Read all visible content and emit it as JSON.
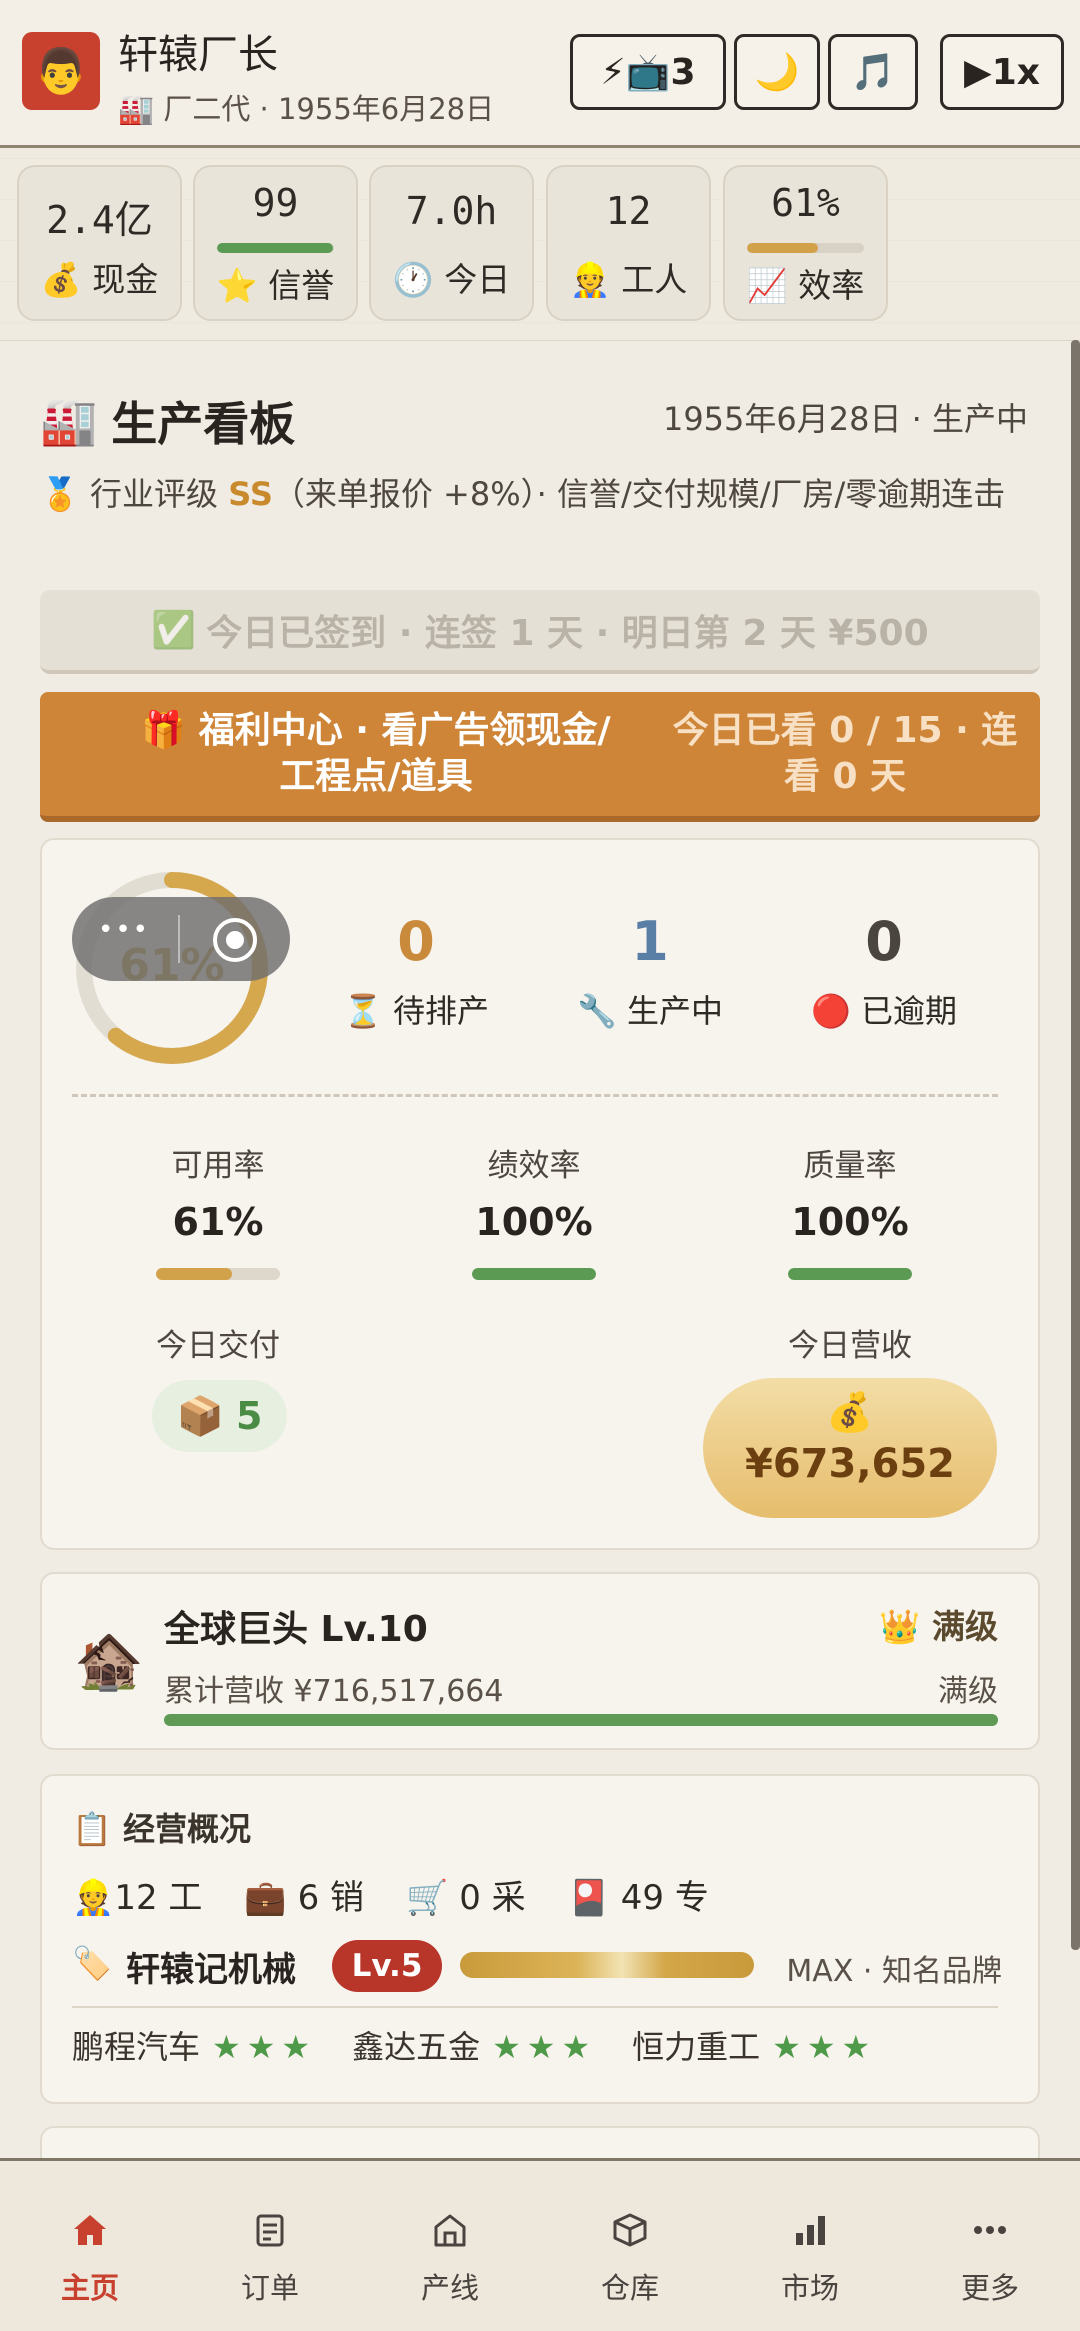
{
  "header": {
    "avatar_emoji": "👨",
    "user_name": "轩辕厂长",
    "user_sub_icon": "🏭",
    "user_sub": "厂二代 · 1955年6月28日",
    "btn_ad": "⚡📺3",
    "btn_night": "🌙",
    "btn_music": "🎵",
    "btn_speed": "▶1x"
  },
  "stats": [
    {
      "value": "2.4亿",
      "icon": "💰",
      "label": "现金"
    },
    {
      "value": "99",
      "icon": "⭐",
      "label": "信誉",
      "bar": 0.99,
      "bar_color": "#5a9a52"
    },
    {
      "value": "7.0h",
      "icon": "🕐",
      "label": "今日"
    },
    {
      "value": "12",
      "icon": "👷",
      "label": "工人"
    },
    {
      "value": "61%",
      "icon": "📈",
      "label": "效率",
      "bar": 0.61,
      "bar_color": "#d2a24a"
    }
  ],
  "board": {
    "icon": "🏭",
    "title": "生产看板",
    "date": "1955年6月28日 · 生产中",
    "rating_icon": "🏅",
    "rating_prefix": "行业评级 ",
    "rating_grade": "SS",
    "rating_suffix": "（来单报价 +8%）· 信誉/交付规模/厂房/零逾期连击"
  },
  "checkin": {
    "icon": "✅",
    "text": "今日已签到 · 连签 1 天 · 明日第 2 天 ¥500"
  },
  "welfare": {
    "icon": "🎁",
    "left_line1": "福利中心 · 看广告领现金/",
    "left_line2": "工程点/道具",
    "right_line1": "今日已看 0 / 15 · 连",
    "right_line2": "看 0 天"
  },
  "production": {
    "ring_percent_text": "61%",
    "ring_value": 0.61,
    "overlay_dots": "•••",
    "pending": {
      "value": "0",
      "icon": "⏳",
      "label": "待排产",
      "color": "#c98a3b"
    },
    "producing": {
      "value": "1",
      "icon": "🔧",
      "label": "生产中",
      "color": "#5a7fa6"
    },
    "overdue": {
      "value": "0",
      "icon": "🔴",
      "label": "已逾期",
      "color": "#4b4540"
    },
    "metrics": [
      {
        "label": "可用率",
        "value": "61%",
        "level": 0.61,
        "color": "#d2a24a"
      },
      {
        "label": "绩效率",
        "value": "100%",
        "level": 1.0,
        "color": "#5a9a52"
      },
      {
        "label": "质量率",
        "value": "100%",
        "level": 1.0,
        "color": "#5a9a52"
      }
    ],
    "delivery_label": "今日交付",
    "delivery_icon": "📦",
    "delivery_value": "5",
    "revenue_label": "今日营收",
    "revenue_icon": "💰",
    "revenue_value": "¥673,652"
  },
  "level": {
    "icon": "🏚️",
    "title": "全球巨头 Lv.10",
    "crown_icon": "👑",
    "badge": "满级",
    "revenue": "累计营收 ¥716,517,664",
    "status": "满级",
    "progress": 1.0
  },
  "overview": {
    "icon": "📋",
    "title": "经营概况",
    "staff": [
      {
        "icon": "👷",
        "text": "12 工"
      },
      {
        "icon": "💼",
        "text": "6 销"
      },
      {
        "icon": "🛒",
        "text": "0 采"
      },
      {
        "icon": "🎴",
        "text": "49 专"
      }
    ],
    "brand_icon": "🏷️",
    "brand_name": "轩辕记机械",
    "brand_level": "Lv.5",
    "brand_status": "MAX · 知名品牌",
    "partners": [
      {
        "name": "鹏程汽车",
        "stars": "★★★"
      },
      {
        "name": "鑫达五金",
        "stars": "★★★"
      },
      {
        "name": "恒力重工",
        "stars": "★★★"
      }
    ]
  },
  "nav": [
    {
      "label": "主页",
      "icon": "home-icon",
      "active": true
    },
    {
      "label": "订单",
      "icon": "orders-icon"
    },
    {
      "label": "产线",
      "icon": "factory-icon"
    },
    {
      "label": "仓库",
      "icon": "warehouse-icon"
    },
    {
      "label": "市场",
      "icon": "market-icon"
    },
    {
      "label": "更多",
      "icon": "more-icon"
    }
  ],
  "colors": {
    "accent": "#c8402e",
    "gold": "#d2a24a",
    "green": "#5a9a52",
    "orange": "#ce8538"
  }
}
